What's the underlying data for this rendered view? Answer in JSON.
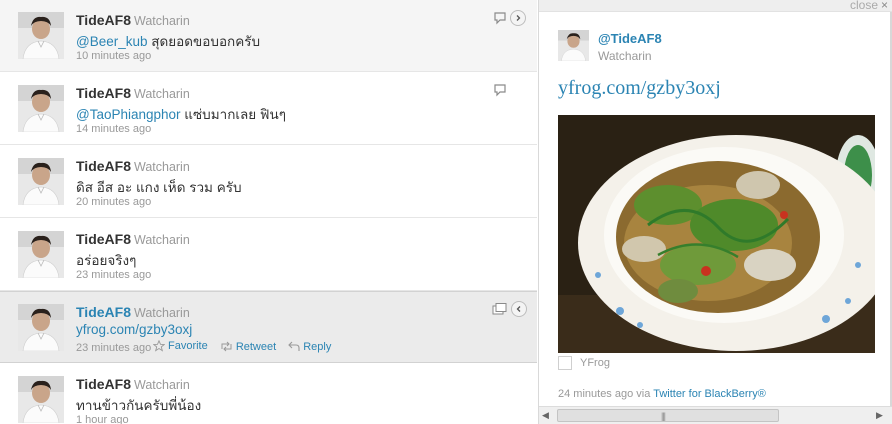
{
  "timeline": {
    "tweets": [
      {
        "screen_name": "TideAF8",
        "full_name": "Watcharin",
        "mention": "@Beer_kub",
        "text": " สุดยอดขอบอกครับ",
        "time": "10 minutes ago",
        "variant": "hover"
      },
      {
        "screen_name": "TideAF8",
        "full_name": "Watcharin",
        "mention": "@TaoPhiangphor",
        "text": " แซ่บมากเลย ฟินๆ",
        "time": "14 minutes ago",
        "variant": "normal"
      },
      {
        "screen_name": "TideAF8",
        "full_name": "Watcharin",
        "mention": "",
        "text": "ดิส อีส อะ แกง เห็ด รวม ครับ",
        "time": "20 minutes ago",
        "variant": "normal"
      },
      {
        "screen_name": "TideAF8",
        "full_name": "Watcharin",
        "mention": "",
        "text": "อร่อยจริงๆ",
        "time": "23 minutes ago",
        "variant": "normal"
      },
      {
        "screen_name": "TideAF8",
        "full_name": "Watcharin",
        "mention": "",
        "link": "yfrog.com/gzby3oxj",
        "text": "",
        "time": "23 minutes ago",
        "variant": "selected"
      },
      {
        "screen_name": "TideAF8",
        "full_name": "Watcharin",
        "mention": "",
        "text": "ทานข้าวกันครับพี่น้อง",
        "time": "1 hour ago",
        "variant": "normal"
      }
    ],
    "actions": {
      "favorite": "Favorite",
      "retweet": "Retweet",
      "reply": "Reply"
    }
  },
  "detail": {
    "close_label": "close",
    "close_icon": "×",
    "handle": "@TideAF8",
    "name": "Watcharin",
    "link": "yfrog.com/gzby3oxj",
    "media_provider": "YFrog",
    "time": "24 minutes ago",
    "via": " via ",
    "source": "Twitter for BlackBerry®"
  },
  "colors": {
    "link": "#2b84b3",
    "muted": "#999999",
    "selected_row": "#ebebeb",
    "hover_row": "#f5f5f5"
  }
}
